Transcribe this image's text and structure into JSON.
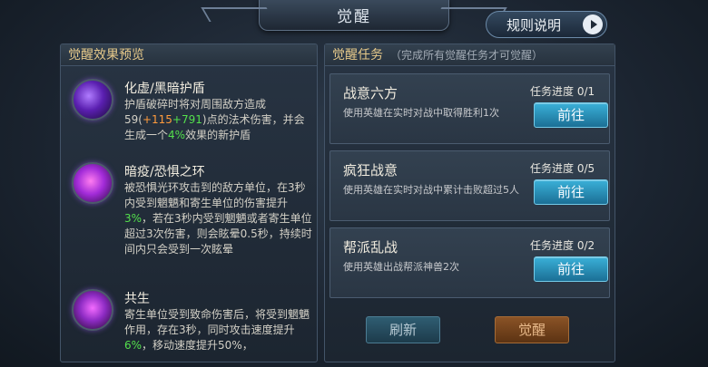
{
  "header": {
    "title": "觉醒",
    "rules_label": "规则说明"
  },
  "left_panel": {
    "title": "觉醒效果预览",
    "effects": [
      {
        "icon": "dark-shield-icon",
        "name": "化虚/黑暗护盾",
        "desc_a": "护盾破碎时将对周围敌方造成59(",
        "desc_plus1": "+",
        "desc_b1": "115",
        "desc_plus2": "+791",
        "desc_c": ")点的法术伤害，并会生成一个",
        "desc_pct": "4%",
        "desc_d": "效果的新护盾"
      },
      {
        "icon": "fear-ring-icon",
        "name": "暗疫/恐惧之环",
        "desc_a": "被恐惧光环攻击到的敌方单位，在3秒内受到魍魉和寄生单位的伤害提升",
        "desc_pct": "3%",
        "desc_b": "，若在3秒内受到魍魉或者寄生单位超过3次伤害，则会眩晕0.5秒，持续时间内只会受到一次眩晕"
      },
      {
        "icon": "symbiosis-icon",
        "name": "共生",
        "desc_a": "寄生单位受到致命伤害后，将受到魍魉作用，存在3秒，同时攻击速度提升",
        "desc_pct": "6%",
        "desc_b": "，移动速度提升50%，"
      }
    ]
  },
  "right_panel": {
    "title": "觉醒任务",
    "subtitle": "（完成所有觉醒任务才可觉醒）",
    "tasks": [
      {
        "name": "战意六方",
        "desc": "使用英雄在实时对战中取得胜利1次",
        "progress": "任务进度 0/1",
        "button": "前往"
      },
      {
        "name": "疯狂战意",
        "desc": "使用英雄在实时对战中累计击败超过5人",
        "progress": "任务进度 0/5",
        "button": "前往"
      },
      {
        "name": "帮派乱战",
        "desc": "使用英雄出战帮派神兽2次",
        "progress": "任务进度 0/2",
        "button": "前往"
      }
    ]
  },
  "footer": {
    "refresh_label": "刷新",
    "awaken_label": "觉醒"
  }
}
